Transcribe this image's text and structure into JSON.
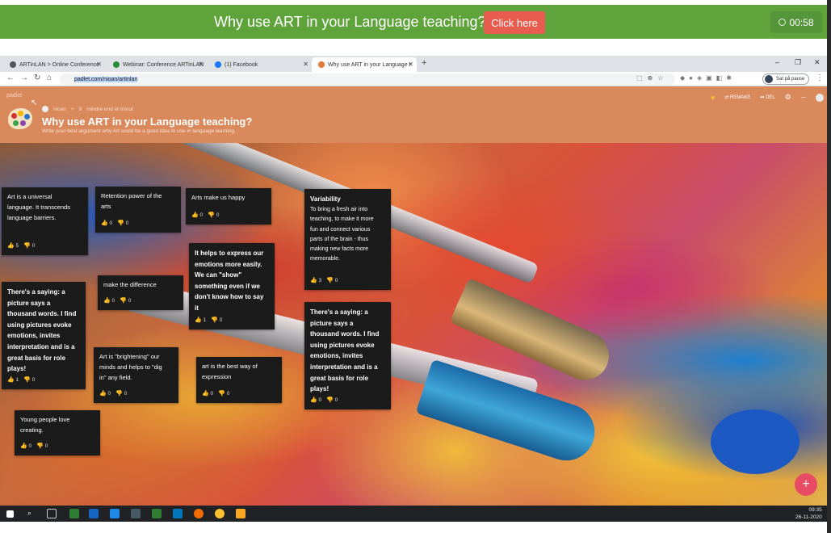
{
  "banner": {
    "title": "Why use ART in your Language teaching?",
    "button": "Click here",
    "timer": "00:58",
    "color": "#5fa43b"
  },
  "browser": {
    "tabs": [
      {
        "label": "ARTinLAN > Online Conference",
        "active": false
      },
      {
        "label": "Webinar: Conference ARTinLAN",
        "active": false
      },
      {
        "label": "(1) Facebook",
        "active": false
      },
      {
        "label": "Why use ART in your Language t",
        "active": true
      }
    ],
    "url": "padlet.com/nioan/artinlan",
    "pause_label": "Sat på pause"
  },
  "padlet": {
    "logo": "padlet",
    "author": "nioan",
    "likes": "9",
    "updated": "mindre end et minut",
    "title": "Why use ART in your Language teaching?",
    "description": "Write your best argument why Art could be a good idea to use in language learning.",
    "remake": "REMAKE",
    "share": "DEL",
    "accent": "#d9895c"
  },
  "notes": [
    {
      "lines": [
        "Art is a universal",
        "language. It transcends",
        "language barriers."
      ],
      "up": "5",
      "down": "0",
      "bold": false
    },
    {
      "lines": [
        "Retention power of the",
        "arts"
      ],
      "up": "0",
      "down": "0",
      "bold": false
    },
    {
      "lines": [
        "Arts make us happy"
      ],
      "up": "0",
      "down": "0",
      "bold": false
    },
    {
      "lines": [
        "Variability"
      ],
      "body": [
        "To bring a fresh air into",
        "teaching, to make it more",
        "fun and connect various",
        "parts of the brain - thus",
        "making new facts more",
        "memorable."
      ],
      "up": "3",
      "down": "0",
      "bold": false
    },
    {
      "lines": [
        "It helps to express our",
        "emotions more easily.",
        "We can \"show\"",
        "something even if we",
        "don't know how to say",
        "it"
      ],
      "up": "1",
      "down": "0",
      "bold": true
    },
    {
      "lines": [
        "make the difference"
      ],
      "up": "0",
      "down": "0",
      "bold": false
    },
    {
      "lines": [
        "There's a saying: a",
        "picture says a",
        "thousand words. I find",
        "using pictures evoke",
        "emotions, invites",
        "interpretation and is a",
        "great basis for role",
        "plays!"
      ],
      "up": "1",
      "down": "0",
      "bold": true
    },
    {
      "lines": [
        "There's a saying: a",
        "picture says a",
        "thousand words. I find",
        "using pictures evoke",
        "emotions, invites",
        "interpretation and is a",
        "great basis for role",
        "plays!"
      ],
      "up": "0",
      "down": "0",
      "bold": true
    },
    {
      "lines": [
        "Art is \"brightening\" our",
        "minds and helps to \"dig",
        "in\" any field."
      ],
      "up": "0",
      "down": "0",
      "bold": false
    },
    {
      "lines": [
        "art is the best way of",
        "expression"
      ],
      "up": "0",
      "down": "0",
      "bold": false
    },
    {
      "lines": [
        "Young people love",
        "creating."
      ],
      "up": "0",
      "down": "0",
      "bold": false
    }
  ],
  "taskbar": {
    "time": "09:35",
    "date": "26-11-2020"
  }
}
